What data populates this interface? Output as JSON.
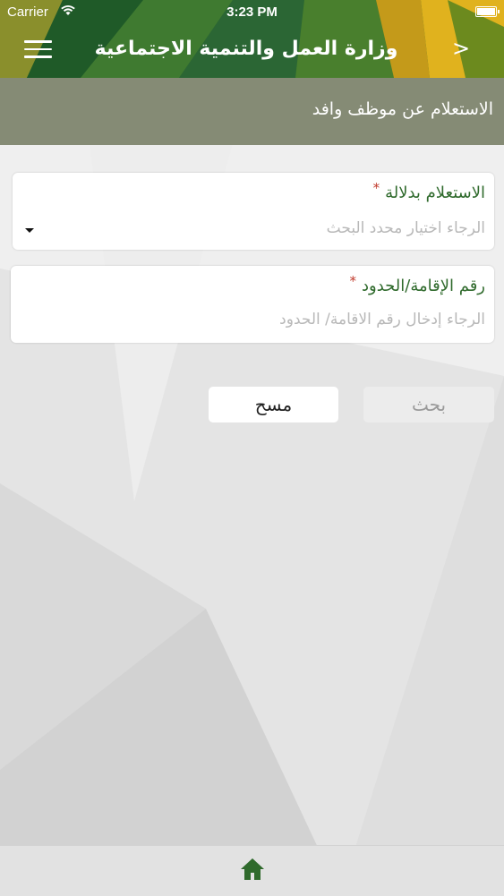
{
  "status_bar": {
    "carrier": "Carrier",
    "time": "3:23 PM"
  },
  "header": {
    "title": "وزارة العمل والتنمية الاجتماعية",
    "back_icon": "chevron-right-icon",
    "menu_icon": "hamburger-menu-icon",
    "back_glyph": ">"
  },
  "subheader": {
    "title": "الاستعلام عن موظف وافد"
  },
  "form": {
    "inquiry_by": {
      "label": "الاستعلام بدلالة",
      "required_mark": "*",
      "placeholder": "الرجاء اختيار محدد البحث"
    },
    "id_number": {
      "label": "رقم الإقامة/الحدود",
      "required_mark": "*",
      "placeholder": "الرجاء إدخال رقم الاقامة/ الحدود"
    }
  },
  "buttons": {
    "search": "بحث",
    "clear": "مسح"
  },
  "bottom_bar": {
    "home_icon": "home-icon"
  },
  "colors": {
    "brand_green": "#2f6a2c",
    "subheader_bg": "#858b75",
    "required_red": "#c0392b",
    "placeholder_gray": "#b8b8b8"
  }
}
